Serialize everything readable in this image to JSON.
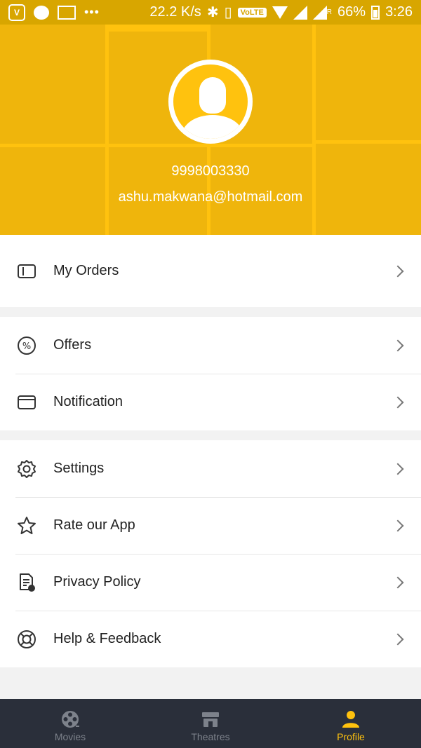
{
  "status_bar": {
    "net_speed": "22.2 K/s",
    "volte": "VoLTE",
    "battery": "66%",
    "time": "3:26",
    "dots": "•••",
    "carrier_mark": "R"
  },
  "profile": {
    "phone": "9998003330",
    "email": "ashu.makwana@hotmail.com"
  },
  "menu": {
    "my_orders": "My Orders",
    "offers": "Offers",
    "notification": "Notification",
    "settings": "Settings",
    "rate_app": "Rate our App",
    "privacy_policy": "Privacy Policy",
    "help_feedback": "Help & Feedback"
  },
  "bottom_nav": {
    "movies": "Movies",
    "theatres": "Theatres",
    "profile": "Profile"
  },
  "colors": {
    "accent": "#ffc20e",
    "nav_bg": "#2a2f3a",
    "nav_inactive": "#7d828b"
  },
  "icons": {
    "my_orders": "ticket-icon",
    "offers": "percent-icon",
    "notification": "envelope-icon",
    "settings": "gear-icon",
    "rate_app": "star-icon",
    "privacy_policy": "document-icon",
    "help_feedback": "lifebuoy-icon",
    "movies": "film-reel-icon",
    "theatres": "theatre-icon",
    "profile": "person-icon"
  }
}
